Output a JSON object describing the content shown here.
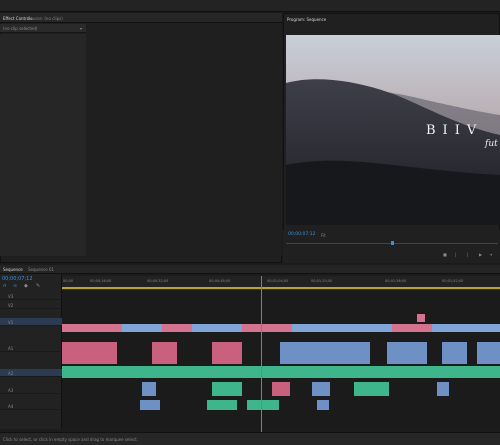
{
  "source_panel": {
    "tabs": [
      "Effect Controls",
      "Source: (no clips)"
    ],
    "dropdown": "(no clip selected)"
  },
  "program": {
    "tab": "Program: Sequence",
    "timecode": "00;00;07;12",
    "fit": "Fit",
    "title_text": "BIIV",
    "subtitle_text": "fut"
  },
  "timeline": {
    "tabs": [
      "Sequence",
      "Sequence 01"
    ],
    "timecode": "00;00;07;12",
    "ruler_ticks": [
      "00;00",
      "00;00;16;00",
      "00;00;32;00",
      "00;00;48;00",
      "00;01;04;00",
      "00;01;20;00",
      "00;01;36;00",
      "00;01;52;00"
    ],
    "track_labels": [
      "V3",
      "V2",
      "V1",
      "A1",
      "A2",
      "A3",
      "A4"
    ],
    "status": "Click to select, or click in empty space and drag to marquee select."
  },
  "colors": {
    "accent": "#3b8fe0",
    "video_clip": "#d4738f",
    "audio_green": "#3fb58b",
    "audio_blue": "#6f90c4"
  }
}
